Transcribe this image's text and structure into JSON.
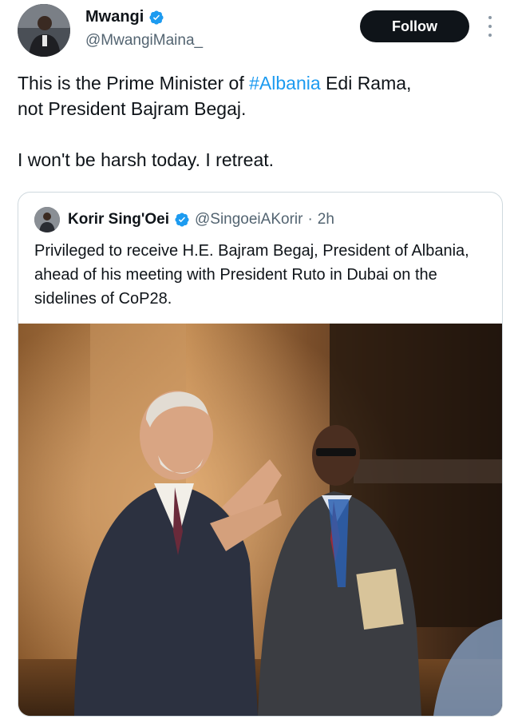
{
  "author": {
    "display_name": "Mwangi",
    "handle": "@MwangiMaina_",
    "verified_icon": "verified-badge-icon",
    "avatar_icon": "user-avatar"
  },
  "follow_label": "Follow",
  "more_icon": "more-vertical-icon",
  "tweet": {
    "line1_before": "This is the Prime Minister of ",
    "hashtag": "#Albania",
    "line1_after": " Edi Rama,",
    "line2": "not President Bajram Begaj.",
    "paragraph2": "I won't be harsh today. I retreat."
  },
  "quoted": {
    "display_name": "Korir Sing'Oei",
    "handle": "@SingoeiAKorir",
    "separator": "·",
    "time": "2h",
    "text": "Privileged to receive H.E. Bajram Begaj, President of Albania, ahead of his meeting with President Ruto in Dubai on the sidelines of CoP28."
  },
  "colors": {
    "accent": "#1d9bf0",
    "follow_bg": "#0f1419",
    "secondary_text": "#536471",
    "border": "#cfd9de"
  }
}
